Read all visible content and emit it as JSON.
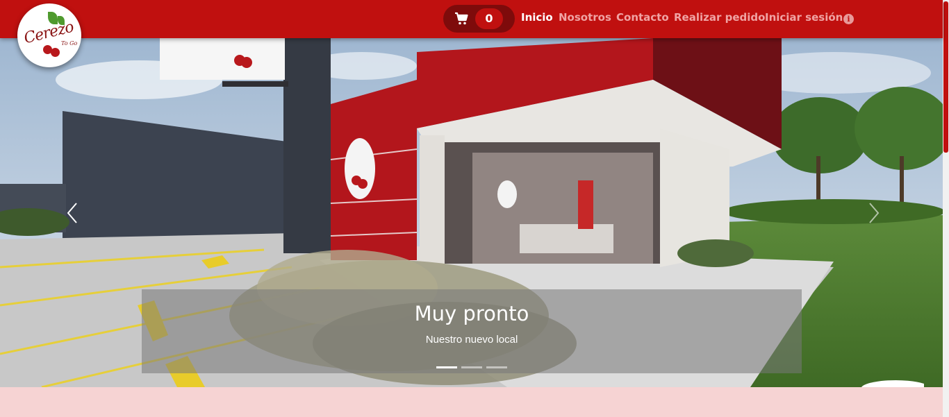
{
  "brand": {
    "logo_text": "Cerezo",
    "logo_sub": "To Go"
  },
  "cart": {
    "count": "0",
    "icon": "cart-icon"
  },
  "nav": {
    "items": [
      {
        "label": "Inicio",
        "active": true
      },
      {
        "label": "Nosotros",
        "active": false
      },
      {
        "label": "Contacto",
        "active": false
      },
      {
        "label": "Realizar pedido",
        "active": false
      },
      {
        "label": "Iniciar sesión",
        "active": false
      }
    ],
    "info_icon": "info-icon"
  },
  "carousel": {
    "caption_title": "Muy pronto",
    "caption_text": "Nuestro nuevo local",
    "slides": 3,
    "active_slide": 1,
    "prev_icon": "chevron-left-icon",
    "next_icon": "chevron-right-icon"
  },
  "colors": {
    "brand_red": "#c0100f",
    "dark_red": "#7e0b0b",
    "footer_pink": "#f6d3d3"
  }
}
